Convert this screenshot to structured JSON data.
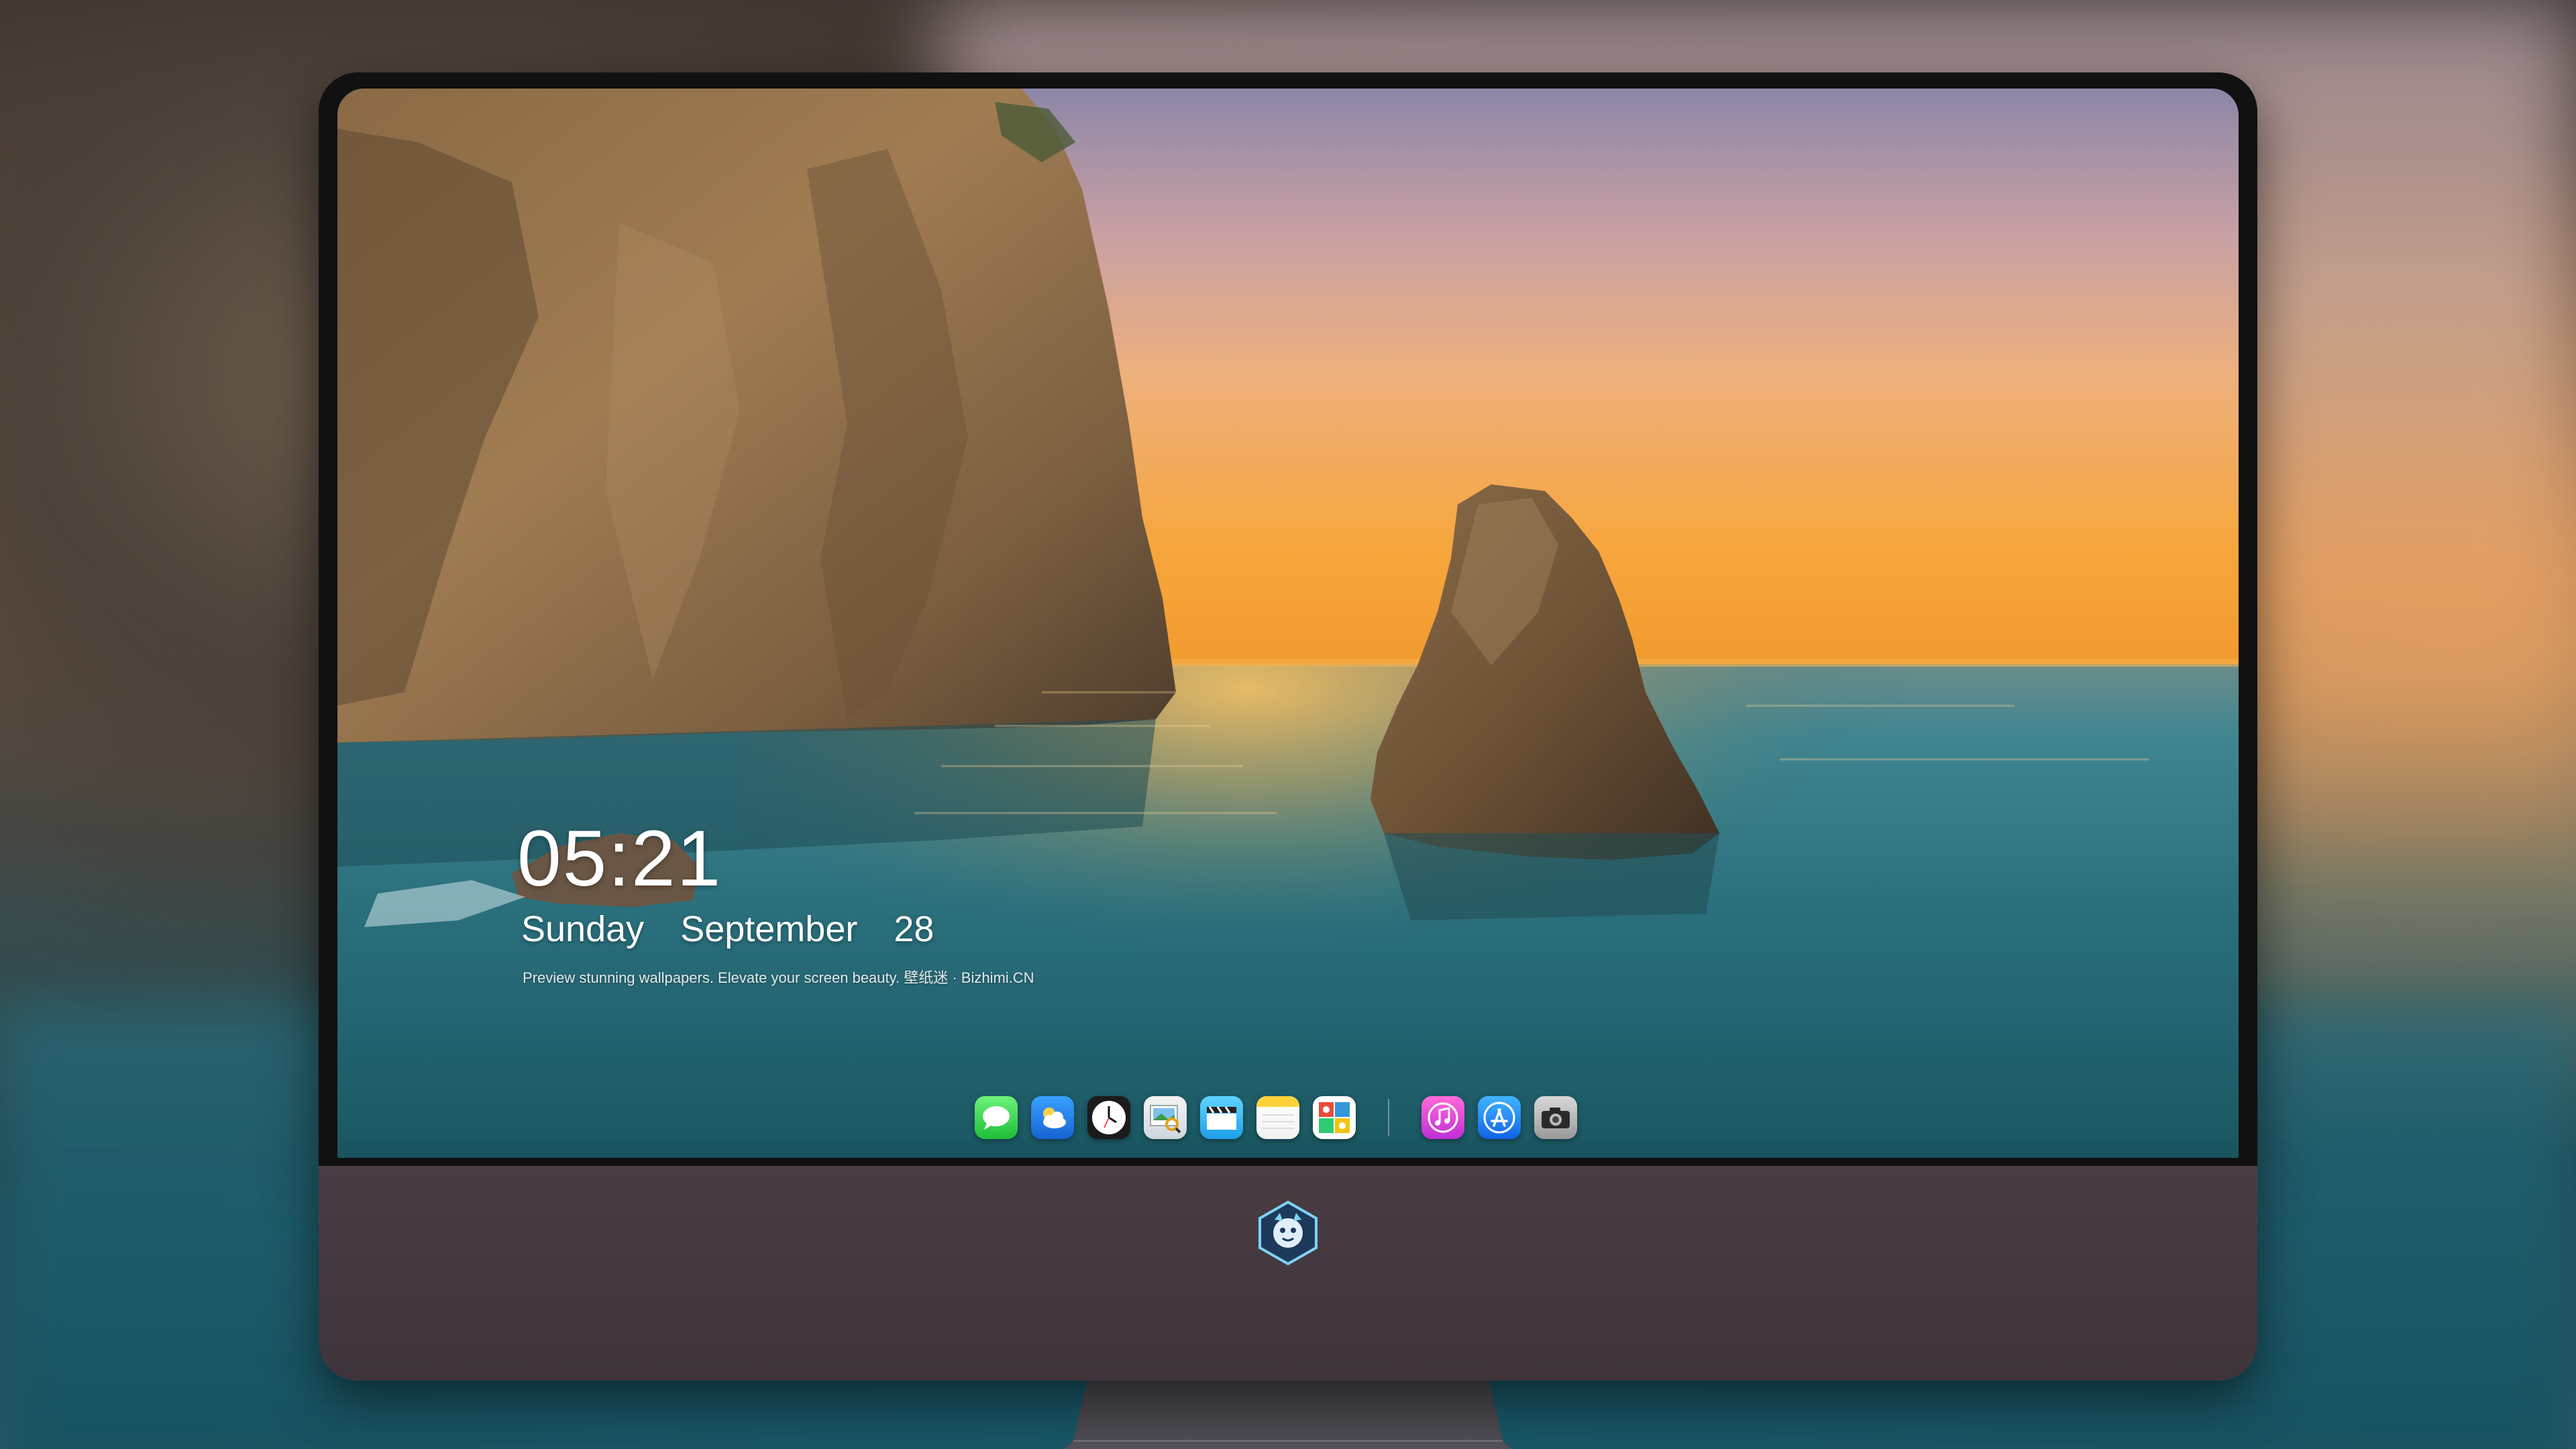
{
  "lockscreen": {
    "time": "05:21",
    "weekday": "Sunday",
    "month": "September",
    "day": "28",
    "tagline": "Preview stunning wallpapers. Elevate your screen beauty. 壁纸迷 · Bizhimi.CN"
  },
  "dock": {
    "apps": [
      {
        "name": "Messages",
        "icon": "speech-bubble-icon",
        "color": "#2fd24a"
      },
      {
        "name": "Weather",
        "icon": "cloud-icon",
        "color": "#2a86f0"
      },
      {
        "name": "Clock",
        "icon": "clock-icon",
        "color": "#1b1b1b"
      },
      {
        "name": "Preview",
        "icon": "photo-loupe-icon",
        "color": "#e6ecf0"
      },
      {
        "name": "Clips",
        "icon": "clapperboard-icon",
        "color": "#38bdf5"
      },
      {
        "name": "Notes",
        "icon": "notepad-icon",
        "color": "#ffd23a"
      },
      {
        "name": "Photo Booth",
        "icon": "photo-grid-icon",
        "color": "#ffffff"
      },
      {
        "name": "Music",
        "icon": "music-note-icon",
        "color": "#e046d8"
      },
      {
        "name": "App Store",
        "icon": "app-store-icon",
        "color": "#2a8cf4"
      },
      {
        "name": "Camera",
        "icon": "camera-icon",
        "color": "#bdbdbd"
      }
    ]
  },
  "monitor": {
    "chin_logo": "kirin-mascot-logo",
    "bezel_color": "#111111",
    "chin_color": "#443a40"
  },
  "wallpaper": {
    "scene": "sea-cliff-sunset",
    "sky_color": "#f6a542",
    "sea_color": "#2a6f7c"
  }
}
